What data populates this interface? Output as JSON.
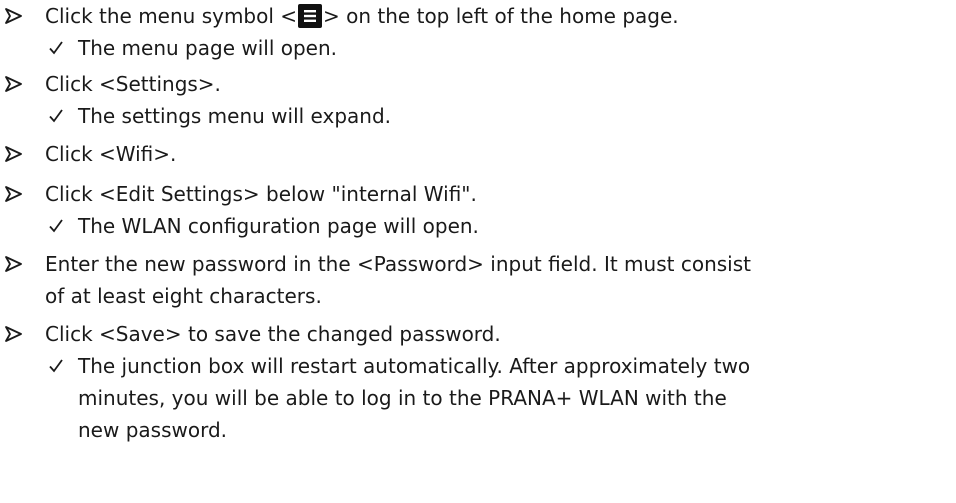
{
  "steps": [
    {
      "text_before": "Click the menu symbol <",
      "icon": "menu-icon",
      "text_after": "> on the top left of the home page.",
      "results": [
        "The menu page will open."
      ]
    },
    {
      "text": "Click <Settings>.",
      "results": [
        "The settings menu will expand."
      ]
    },
    {
      "text": "Click <Wifi>.",
      "results": []
    },
    {
      "text": "Click <Edit Settings> below \"internal Wifi\".",
      "results": [
        "The WLAN configuration page will open."
      ]
    },
    {
      "text_line1": "Enter the new password in the <Password> input field. It must consist",
      "text_line2": "of at least eight characters.",
      "results": []
    },
    {
      "text": "Click <Save> to save the changed password.",
      "result_lines": [
        "The junction box will restart automatically. After approximately two",
        "minutes, you will be able to log in to the PRANA+ WLAN with the",
        "new password."
      ]
    }
  ],
  "colors": {
    "text": "#1a1a1a",
    "icon_bg": "#111111",
    "icon_fg": "#ffffff"
  }
}
